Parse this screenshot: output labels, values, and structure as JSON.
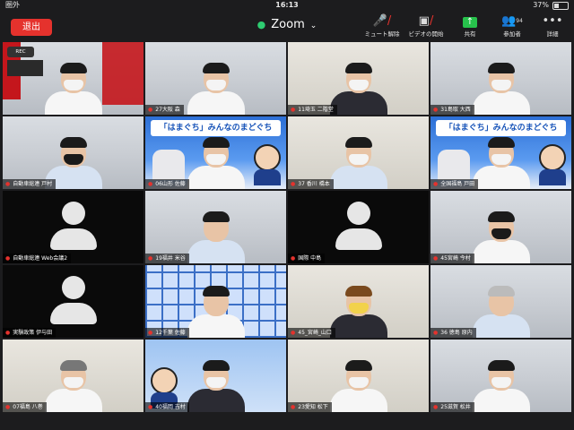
{
  "status_bar": {
    "carrier": "圏外",
    "time": "16:13",
    "battery": "37%"
  },
  "top_bar": {
    "leave_label": "退出",
    "title": "Zoom",
    "controls": [
      {
        "label": "ミュート解除",
        "icon": "mic-off-icon"
      },
      {
        "label": "ビデオの開始",
        "icon": "video-off-icon"
      },
      {
        "label": "共有",
        "icon": "share-screen-icon"
      },
      {
        "label": "参加者",
        "icon": "participants-icon",
        "count": "94"
      },
      {
        "label": "詳細",
        "icon": "more-dots-icon"
      }
    ]
  },
  "recording": {
    "label": "REC"
  },
  "tiles": [
    {
      "name": "",
      "kind": "video-flag"
    },
    {
      "name": "27大阪 森",
      "kind": "video"
    },
    {
      "name": "11埼玉 二階堂",
      "kind": "video"
    },
    {
      "name": "31島取 大西",
      "kind": "video"
    },
    {
      "name": "自動車総連 戸村",
      "kind": "video"
    },
    {
      "name": "06山形 佐藤",
      "kind": "poster",
      "poster_text": "「はまぐち」みんなのまどぐち"
    },
    {
      "name": "37 香川 橋本",
      "kind": "video"
    },
    {
      "name": "全国福島 戸田",
      "kind": "poster",
      "poster_text": "「はまぐち」みんなのまどぐち"
    },
    {
      "name": "自動車総連 Web会議2",
      "kind": "avatar"
    },
    {
      "name": "19福井 米谷",
      "kind": "video"
    },
    {
      "name": "国際 中島",
      "kind": "avatar"
    },
    {
      "name": "45宮崎 今村",
      "kind": "video"
    },
    {
      "name": "実験政策 伊与田",
      "kind": "avatar"
    },
    {
      "name": "12千葉 佐藤",
      "kind": "pattern"
    },
    {
      "name": "45_宮崎_山口",
      "kind": "video"
    },
    {
      "name": "36 徳島 原内",
      "kind": "video"
    },
    {
      "name": "07福島 八巻",
      "kind": "video"
    },
    {
      "name": "40福岡 吉村",
      "kind": "poster2"
    },
    {
      "name": "23愛知 松下",
      "kind": "video"
    },
    {
      "name": "25滋賀 松井",
      "kind": "video"
    }
  ],
  "colors": {
    "leave": "#e5322d",
    "share": "#27c24c",
    "secure": "#2ecc71"
  }
}
